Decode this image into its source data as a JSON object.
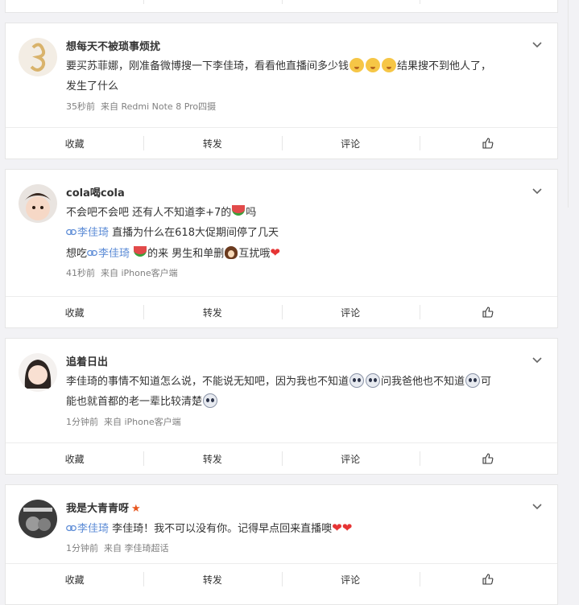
{
  "actions": {
    "collect": "收藏",
    "repost": "转发",
    "comment": "评论"
  },
  "posts": [
    {
      "author": "想每天不被琐事烦扰",
      "line1_a": "要买苏菲娜，刚准备微博搜一下李佳琦，看看他直播间多少钱",
      "line1_b": "结果搜不到他人了，",
      "line2": "发生了什么",
      "time": "35秒前",
      "source": "来自 Redmi Note 8 Pro四摄"
    },
    {
      "author": "cola喝cola",
      "line1_a": "不会吧不会吧 还有人不知道李+7的",
      "line1_b": "吗",
      "line2_mention": "李佳琦",
      "line2_text": " 直播为什么在618大促期间停了几天",
      "line3_a": "想吃",
      "line3_mention": "李佳琦",
      "line3_b": "的来 男生和单删",
      "line3_c": "互扰哦",
      "time": "41秒前",
      "source": "来自 iPhone客户端"
    },
    {
      "author": "追着日出",
      "line1_a": "李佳琦的事情不知道怎么说，不能说无知吧，因为我也不知道",
      "line1_b": "问我爸他也不知道",
      "line1_c": "可",
      "line2": "能也就首都的老一辈比较清楚",
      "time": "1分钟前",
      "source": "来自 iPhone客户端"
    },
    {
      "author": "我是大青青呀",
      "mention": "李佳琦",
      "text": " 李佳琦！我不可以没有你。记得早点回来直播噢",
      "time": "1分钟前",
      "source": "来自 李佳琦超话"
    }
  ]
}
